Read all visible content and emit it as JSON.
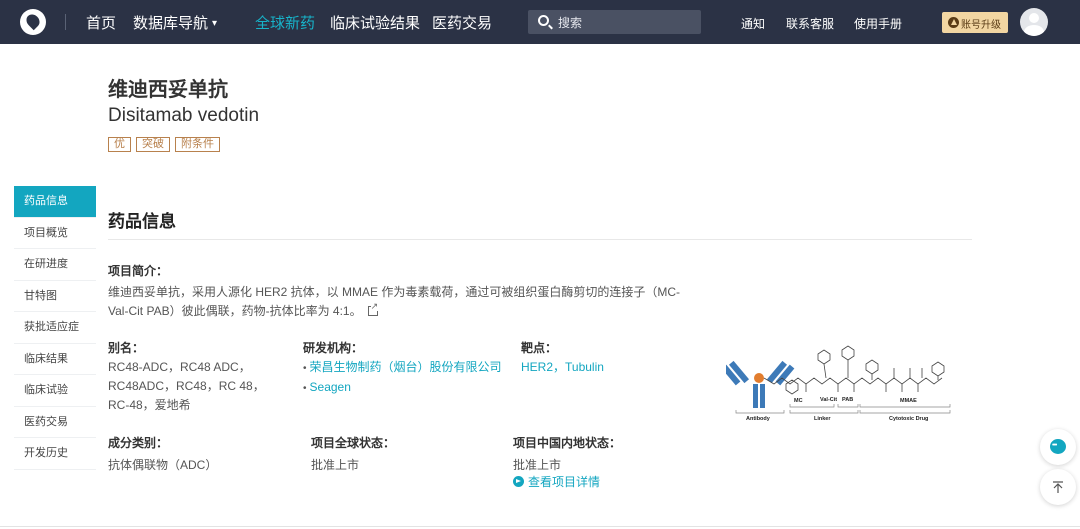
{
  "nav": {
    "items": [
      {
        "label": "首页"
      },
      {
        "label": "数据库导航",
        "has_dropdown": true
      },
      {
        "label": "全球新药",
        "active": true
      },
      {
        "label": "临床试验结果"
      },
      {
        "label": "医药交易"
      }
    ],
    "search_placeholder": "搜索",
    "links": [
      "通知",
      "联系客服",
      "使用手册"
    ],
    "upgrade_label": "账号升级",
    "accent_color": "#17b3c9",
    "bg_color": "#2b3245"
  },
  "drug": {
    "name_cn": "维迪西妥单抗",
    "name_en": "Disitamab vedotin",
    "tags": [
      "优",
      "突破",
      "附条件"
    ]
  },
  "sidebar": {
    "items": [
      "药品信息",
      "项目概览",
      "在研进度",
      "甘特图",
      "获批适应症",
      "临床结果",
      "临床试验",
      "医药交易",
      "开发历史"
    ],
    "active_index": 0
  },
  "section": {
    "title": "药品信息",
    "intro_label": "项目简介：",
    "intro_text": "维迪西妥单抗，采用人源化 HER2 抗体，以 MMAE 作为毒素载荷，通过可被组织蛋白酶剪切的连接子（MC-Val-Cit PAB）彼此偶联，药物-抗体比率为 4:1。",
    "alias_label": "别名：",
    "alias_text": "RC48-ADC，RC48 ADC，RC48ADC，RC48，RC 48，RC-48，爱地希",
    "org_label": "研发机构：",
    "orgs": [
      "荣昌生物制药（烟台）股份有限公司",
      "Seagen"
    ],
    "target_label": "靶点：",
    "targets": "HER2，Tubulin",
    "category_label": "成分类别：",
    "category_value": "抗体偶联物（ADC）",
    "global_status_label": "项目全球状态：",
    "global_status_value": "批准上市",
    "china_status_label": "项目中国内地状态：",
    "china_status_value": "批准上市",
    "detail_link": "查看项目详情"
  },
  "structure_labels": {
    "mc": "MC",
    "valcit": "Val-Cit",
    "pab": "PAB",
    "mmae": "MMAE",
    "antibody": "Antibody",
    "linker": "Linker",
    "drug": "Cytotoxic Drug"
  }
}
